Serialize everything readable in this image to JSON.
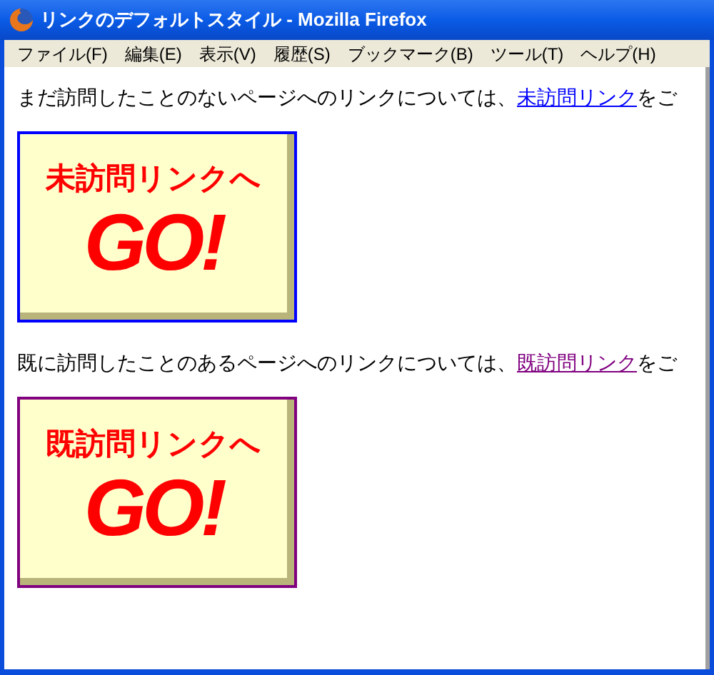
{
  "window": {
    "title": "リンクのデフォルトスタイル - Mozilla Firefox"
  },
  "menu": [
    "ファイル(F)",
    "編集(E)",
    "表示(V)",
    "履歴(S)",
    "ブックマーク(B)",
    "ツール(T)",
    "ヘルプ(H)"
  ],
  "sections": [
    {
      "before": "まだ訪問したことのないページへのリンクについては、",
      "link": "未訪問リンク",
      "after": "をご",
      "visited": false,
      "banner": {
        "caption": "未訪問リンクへ",
        "go": "GO!"
      }
    },
    {
      "before": "既に訪問したことのあるページへのリンクについては、",
      "link": "既訪問リンク",
      "after": "をご",
      "visited": true,
      "banner": {
        "caption": "既訪問リンクへ",
        "go": "GO!"
      }
    }
  ]
}
